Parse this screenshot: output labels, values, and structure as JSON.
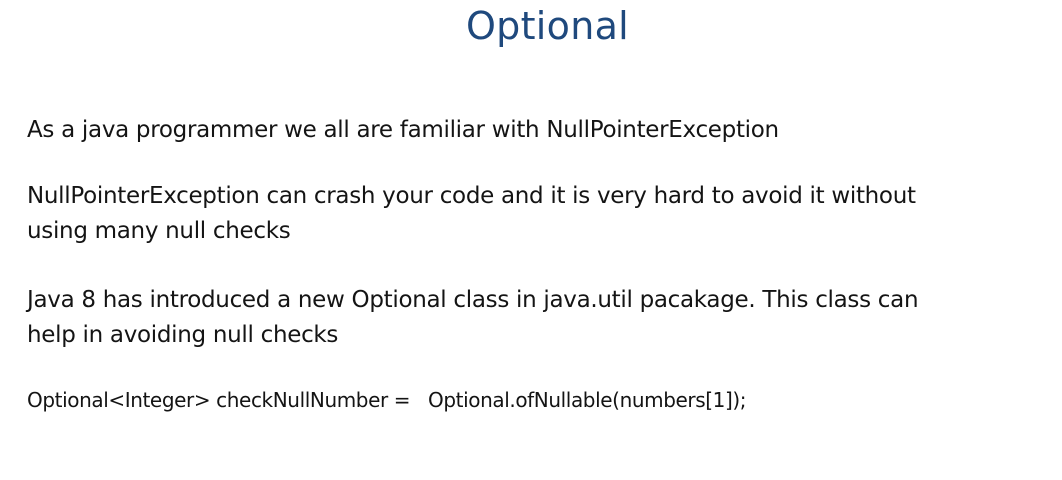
{
  "slide": {
    "title": "Optional",
    "paragraphs": [
      {
        "lines": [
          "As a java programmer we all are familiar with NullPointerException"
        ]
      },
      {
        "lines": [
          "NullPointerException can crash your code and it is very hard to avoid it without",
          "using many null checks"
        ]
      },
      {
        "lines": [
          "Java 8 has introduced a new Optional class in java.util pacakage. This class can",
          "help in avoiding null checks"
        ]
      }
    ],
    "code_line": "Optional<Integer> checkNullNumber =   Optional.ofNullable(numbers[1]);"
  }
}
